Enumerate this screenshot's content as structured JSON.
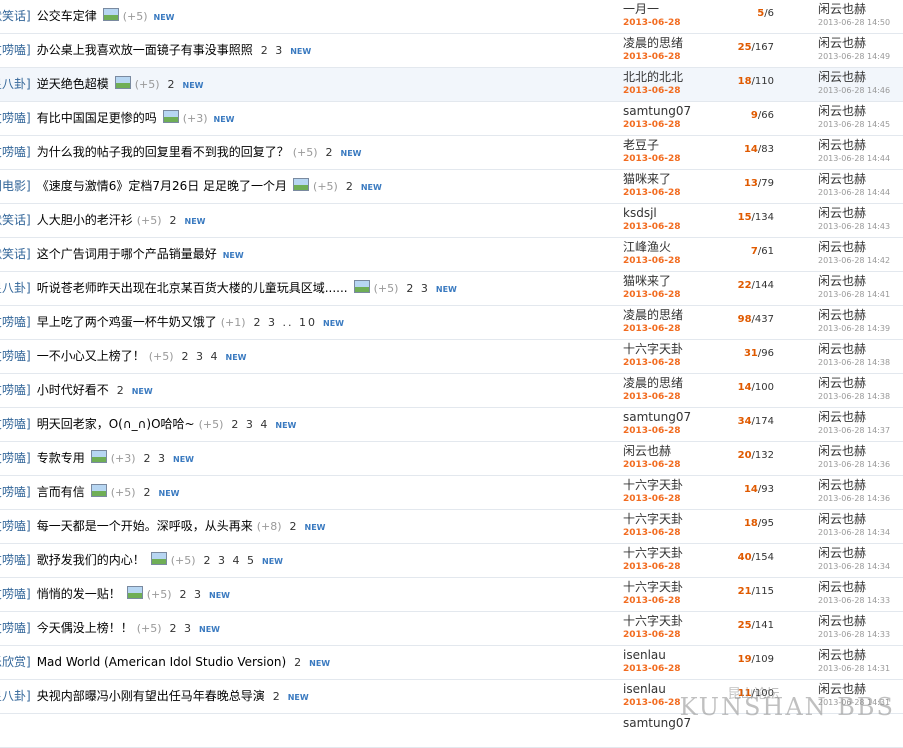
{
  "threads": [
    {
      "cat": "默笑话]",
      "title": "公交车定律",
      "img": true,
      "plus": "(+5)",
      "pages": "",
      "author": "一月一",
      "date": "2013-06-28",
      "replies": "5",
      "views": "6",
      "lastby": "闲云也赫",
      "lastdate": "2013-06-28 14:50"
    },
    {
      "cat": "友唠嗑]",
      "title": "办公桌上我喜欢放一面镜子有事没事照照",
      "img": false,
      "plus": "",
      "pages": "2 3",
      "author": "凌晨的思绪",
      "date": "2013-06-28",
      "replies": "25",
      "views": "167",
      "lastby": "闲云也赫",
      "lastdate": "2013-06-28 14:49"
    },
    {
      "cat": "星八卦]",
      "title": "逆天绝色超模",
      "img": true,
      "plus": "(+5)",
      "pages": "2",
      "author": "北北的北北",
      "date": "2013-06-28",
      "replies": "18",
      "views": "110",
      "lastby": "闲云也赫",
      "lastdate": "2013-06-28 14:46"
    },
    {
      "cat": "友唠嗑]",
      "title": "有比中国国足更惨的吗",
      "img": true,
      "plus": "(+3)",
      "pages": "",
      "author": "samtung07",
      "date": "2013-06-28",
      "replies": "9",
      "views": "66",
      "lastby": "闲云也赫",
      "lastdate": "2013-06-28 14:45"
    },
    {
      "cat": "友唠嗑]",
      "title": "为什么我的帖子我的回复里看不到我的回复了？",
      "img": false,
      "plus": "(+5)",
      "pages": "2",
      "author": "老豆子",
      "date": "2013-06-28",
      "replies": "14",
      "views": "83",
      "lastby": "闲云也赫",
      "lastdate": "2013-06-28 14:44"
    },
    {
      "cat": "剧电影]",
      "title": "《速度与激情6》定档7月26日 足足晚了一个月",
      "img": true,
      "plus": "(+5)",
      "pages": "2",
      "author": "猫咪来了",
      "date": "2013-06-28",
      "replies": "13",
      "views": "79",
      "lastby": "闲云也赫",
      "lastdate": "2013-06-28 14:44"
    },
    {
      "cat": "默笑话]",
      "title": "人大胆小的老汗衫",
      "img": false,
      "plus": "(+5)",
      "pages": "2",
      "author": "ksdsjl",
      "date": "2013-06-28",
      "replies": "15",
      "views": "134",
      "lastby": "闲云也赫",
      "lastdate": "2013-06-28 14:43"
    },
    {
      "cat": "默笑话]",
      "title": "这个广告词用于哪个产品销量最好",
      "img": false,
      "plus": "",
      "pages": "",
      "author": "江峰渔火",
      "date": "2013-06-28",
      "replies": "7",
      "views": "61",
      "lastby": "闲云也赫",
      "lastdate": "2013-06-28 14:42"
    },
    {
      "cat": "星八卦]",
      "title": "听说苍老师昨天出现在北京某百货大楼的儿童玩具区域......",
      "img": true,
      "plus": "(+5)",
      "pages": "2 3",
      "author": "猫咪来了",
      "date": "2013-06-28",
      "replies": "22",
      "views": "144",
      "lastby": "闲云也赫",
      "lastdate": "2013-06-28 14:41"
    },
    {
      "cat": "友唠嗑]",
      "title": "早上吃了两个鸡蛋一杯牛奶又饿了",
      "img": false,
      "plus": "(+1)",
      "pages": "2 3 .. 10",
      "author": "凌晨的思绪",
      "date": "2013-06-28",
      "replies": "98",
      "views": "437",
      "lastby": "闲云也赫",
      "lastdate": "2013-06-28 14:39"
    },
    {
      "cat": "友唠嗑]",
      "title": "一不小心又上榜了！",
      "img": false,
      "plus": "(+5)",
      "pages": "2 3 4",
      "author": "十六字天卦",
      "date": "2013-06-28",
      "replies": "31",
      "views": "96",
      "lastby": "闲云也赫",
      "lastdate": "2013-06-28 14:38"
    },
    {
      "cat": "友唠嗑]",
      "title": "小时代好看不",
      "img": false,
      "plus": "",
      "pages": "2",
      "author": "凌晨的思绪",
      "date": "2013-06-28",
      "replies": "14",
      "views": "100",
      "lastby": "闲云也赫",
      "lastdate": "2013-06-28 14:38"
    },
    {
      "cat": "友唠嗑]",
      "title": "明天回老家，O(∩_∩)O哈哈~",
      "img": false,
      "plus": "(+5)",
      "pages": "2 3 4",
      "author": "samtung07",
      "date": "2013-06-28",
      "replies": "34",
      "views": "174",
      "lastby": "闲云也赫",
      "lastdate": "2013-06-28 14:37"
    },
    {
      "cat": "友唠嗑]",
      "title": "专款专用",
      "img": true,
      "plus": "(+3)",
      "pages": "2 3",
      "author": "闲云也赫",
      "date": "2013-06-28",
      "replies": "20",
      "views": "132",
      "lastby": "闲云也赫",
      "lastdate": "2013-06-28 14:36"
    },
    {
      "cat": "友唠嗑]",
      "title": "言而有信",
      "img": true,
      "plus": "(+5)",
      "pages": "2",
      "author": "十六字天卦",
      "date": "2013-06-28",
      "replies": "14",
      "views": "93",
      "lastby": "闲云也赫",
      "lastdate": "2013-06-28 14:36"
    },
    {
      "cat": "友唠嗑]",
      "title": "每一天都是一个开始。深呼吸，从头再来",
      "img": false,
      "plus": "(+8)",
      "pages": "2",
      "author": "十六字天卦",
      "date": "2013-06-28",
      "replies": "18",
      "views": "95",
      "lastby": "闲云也赫",
      "lastdate": "2013-06-28 14:34"
    },
    {
      "cat": "友唠嗑]",
      "title": "歌抒发我们的内心！",
      "img": true,
      "plus": "(+5)",
      "pages": "2 3 4 5",
      "author": "十六字天卦",
      "date": "2013-06-28",
      "replies": "40",
      "views": "154",
      "lastby": "闲云也赫",
      "lastdate": "2013-06-28 14:34"
    },
    {
      "cat": "友唠嗑]",
      "title": "悄悄的发一贴！",
      "img": true,
      "plus": "(+5)",
      "pages": "2 3",
      "author": "十六字天卦",
      "date": "2013-06-28",
      "replies": "21",
      "views": "115",
      "lastby": "闲云也赫",
      "lastdate": "2013-06-28 14:33"
    },
    {
      "cat": "友唠嗑]",
      "title": "今天偶没上榜！！",
      "img": false,
      "plus": "(+5)",
      "pages": "2 3",
      "author": "十六字天卦",
      "date": "2013-06-28",
      "replies": "25",
      "views": "141",
      "lastby": "闲云也赫",
      "lastdate": "2013-06-28 14:33"
    },
    {
      "cat": "乐欣赏]",
      "title": "Mad World (American Idol Studio Version)",
      "img": false,
      "plus": "",
      "pages": "2",
      "author": "isenlau",
      "date": "2013-06-28",
      "replies": "19",
      "views": "109",
      "lastby": "闲云也赫",
      "lastdate": "2013-06-28 14:31"
    },
    {
      "cat": "星八卦]",
      "title": "央视内部曝冯小刚有望出任马年春晚总导演",
      "img": false,
      "plus": "",
      "pages": "2",
      "author": "isenlau",
      "date": "2013-06-28",
      "replies": "11",
      "views": "100",
      "lastby": "闲云也赫",
      "lastdate": "2013-06-28 14:31"
    },
    {
      "cat": "",
      "title": "",
      "img": false,
      "plus": "",
      "pages": "",
      "author": "samtung07",
      "date": "",
      "replies": "",
      "views": "",
      "lastby": "",
      "lastdate": ""
    }
  ],
  "new_label": "NEW",
  "watermark": {
    "cn": "昆山论坛",
    "en": "KUNSHAN BBS"
  }
}
